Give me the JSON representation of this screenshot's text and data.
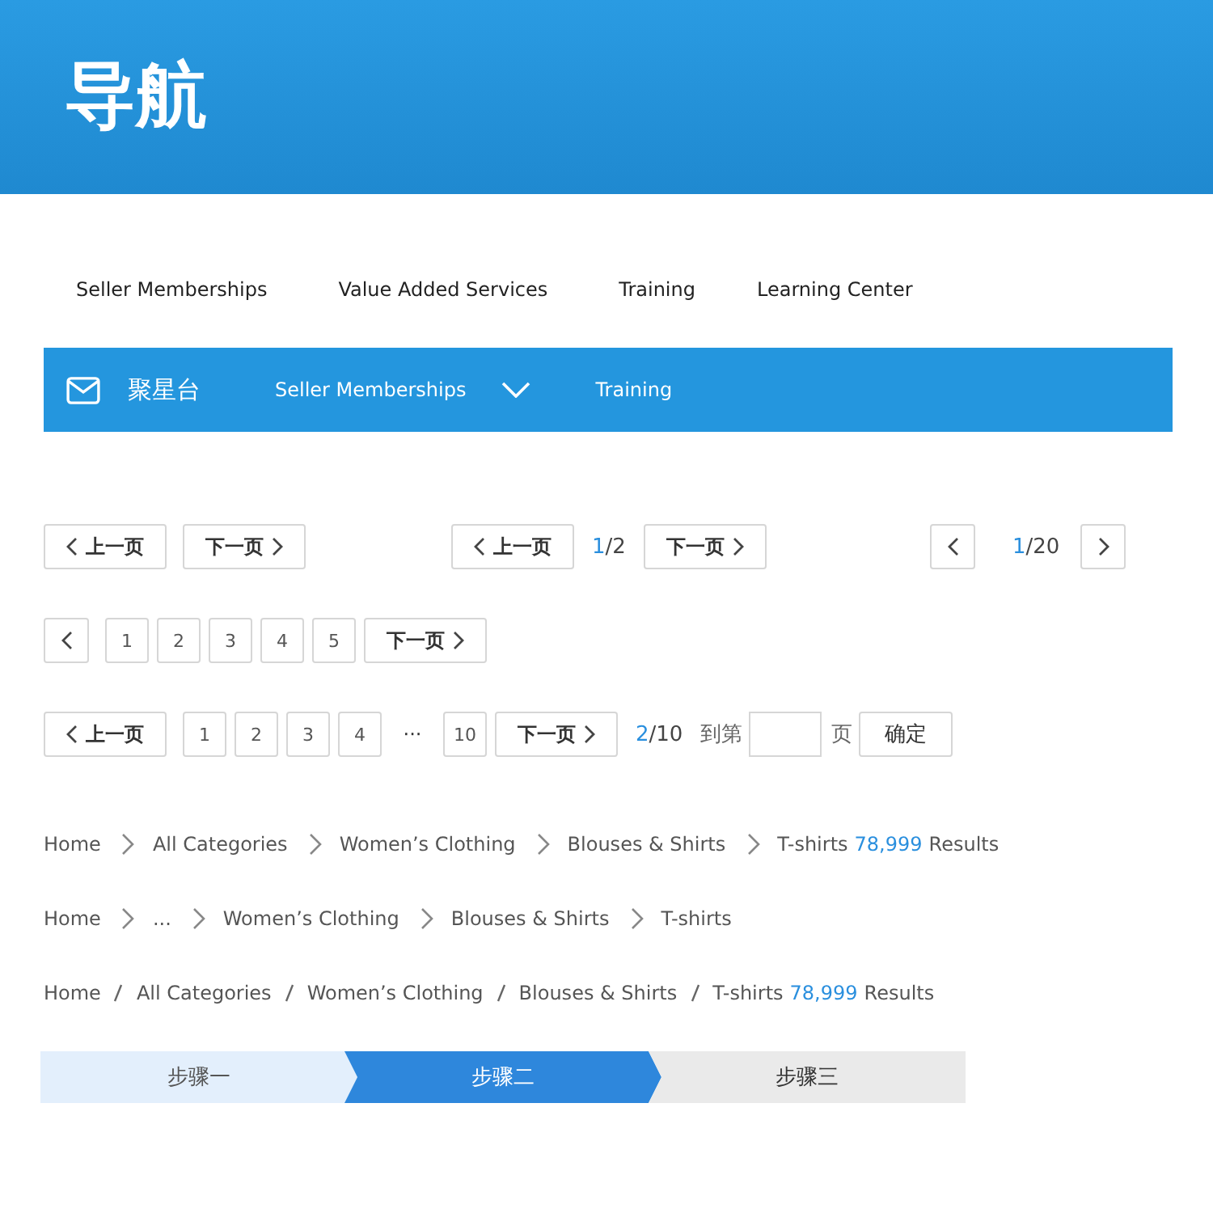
{
  "header": {
    "title": "导航"
  },
  "top_nav": [
    {
      "label": "Seller Memberships"
    },
    {
      "label": "Value Added Services"
    },
    {
      "label": "Training"
    },
    {
      "label": "Learning Center"
    }
  ],
  "nav_bar": {
    "brand": "聚星台",
    "items": [
      {
        "label": "Seller Memberships",
        "dropdown": true
      },
      {
        "label": "Training",
        "dropdown": false
      }
    ]
  },
  "pager_rows": [
    [
      {
        "items": [
          {
            "kind": "prev",
            "label": "上一页"
          },
          {
            "kind": "next",
            "label": "下一页"
          }
        ]
      },
      {
        "items": [
          {
            "kind": "prev",
            "label": "上一页"
          },
          {
            "kind": "counter",
            "current": "1",
            "total": "/2"
          },
          {
            "kind": "next",
            "label": "下一页"
          }
        ]
      },
      {
        "items": [
          {
            "kind": "prev"
          },
          {
            "kind": "counter",
            "current": "1",
            "total": "/20"
          },
          {
            "kind": "next"
          }
        ]
      }
    ],
    [
      {
        "items": [
          {
            "kind": "prev"
          },
          {
            "kind": "page",
            "label": "1"
          },
          {
            "kind": "page",
            "label": "2"
          },
          {
            "kind": "page",
            "label": "3"
          },
          {
            "kind": "page",
            "label": "4"
          },
          {
            "kind": "page",
            "label": "5"
          },
          {
            "kind": "next",
            "label": "下一页"
          }
        ]
      }
    ],
    [
      {
        "items": [
          {
            "kind": "prev",
            "label": "上一页"
          },
          {
            "kind": "page",
            "label": "1"
          },
          {
            "kind": "page",
            "label": "2"
          },
          {
            "kind": "page",
            "label": "3"
          },
          {
            "kind": "page",
            "label": "4"
          },
          {
            "kind": "ellipsis",
            "label": "···"
          },
          {
            "kind": "page",
            "label": "10"
          },
          {
            "kind": "next",
            "label": "下一页"
          },
          {
            "kind": "counter",
            "current": "2",
            "total": "/10"
          },
          {
            "kind": "jump",
            "label": "到第",
            "suffix": "页",
            "button": "确定"
          }
        ]
      }
    ]
  ],
  "breadcrumbs": [
    {
      "kind": "arrow",
      "items": [
        {
          "label": "Home"
        },
        {
          "label": "All Categories"
        },
        {
          "label": "Women’s Clothing"
        },
        {
          "label": "Blouses & Shirts"
        },
        {
          "label": "T-shirts",
          "count": "78,999",
          "suffix": "Results"
        }
      ]
    },
    {
      "kind": "arrow",
      "items": [
        {
          "label": "Home"
        },
        {
          "label": "..."
        },
        {
          "label": "Women’s Clothing"
        },
        {
          "label": "Blouses & Shirts"
        },
        {
          "label": "T-shirts"
        }
      ]
    },
    {
      "kind": "slash",
      "items": [
        {
          "label": "Home"
        },
        {
          "label": "All Categories"
        },
        {
          "label": "Women’s Clothing"
        },
        {
          "label": "Blouses & Shirts"
        },
        {
          "label": "T-shirts",
          "count": "78,999",
          "suffix": "Results"
        }
      ]
    }
  ],
  "steps": [
    {
      "label": "步骤一",
      "selected": false,
      "done": true
    },
    {
      "label": "步骤二",
      "selected": true,
      "done": false
    },
    {
      "label": "步骤三",
      "selected": false,
      "done": false
    }
  ]
}
